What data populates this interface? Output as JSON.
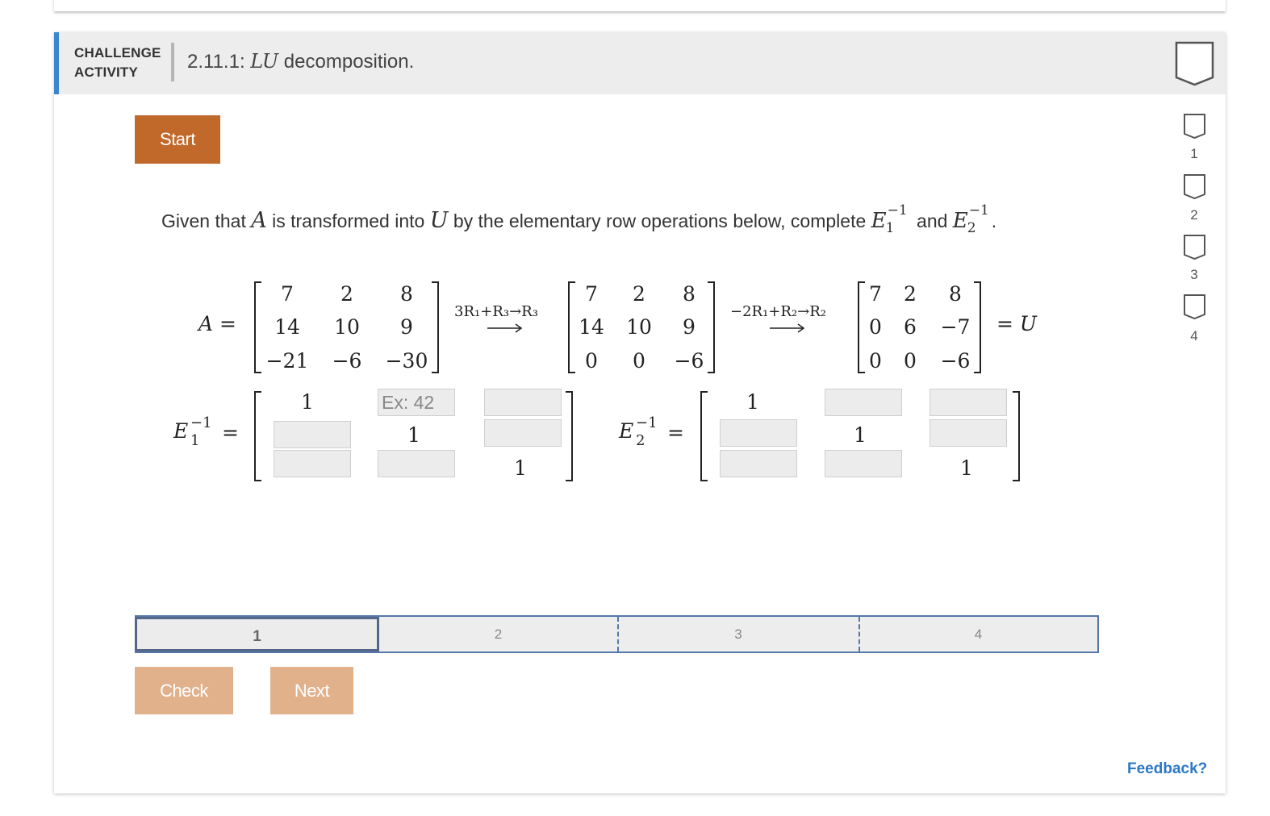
{
  "header": {
    "activity_type_line1": "CHALLENGE",
    "activity_type_line2": "ACTIVITY",
    "number": "2.11.1: ",
    "title_math": "LU",
    "title_text": " decomposition."
  },
  "start_label": "Start",
  "prompt": {
    "text1": "Given that ",
    "A": "A",
    "text2": " is transformed into ",
    "U": "U",
    "text3": " by the elementary row operations below, complete ",
    "E": "E",
    "sub1": "1",
    "sup": "−1",
    "and": " and ",
    "sub2": "2",
    "end": "."
  },
  "matrices": {
    "A_label": "A",
    "equals": "=",
    "A": [
      [
        "7",
        "2",
        "8"
      ],
      [
        "14",
        "10",
        "9"
      ],
      [
        "−21",
        "−6",
        "−30"
      ]
    ],
    "op1": "3R₁+R₃→R₃",
    "M1": [
      [
        "7",
        "2",
        "8"
      ],
      [
        "14",
        "10",
        "9"
      ],
      [
        "0",
        "0",
        "−6"
      ]
    ],
    "op2": "−2R₁+R₂→R₂",
    "U": [
      [
        "7",
        "2",
        "8"
      ],
      [
        "0",
        "6",
        "−7"
      ],
      [
        "0",
        "0",
        "−6"
      ]
    ],
    "U_label": "= U"
  },
  "E1inv": {
    "label_E": "E",
    "label_sub": "1",
    "label_sup": "−1",
    "equals": "=",
    "r1c1": "1",
    "r1c2_placeholder": "Ex: 42",
    "r2c2": "1",
    "r3c3": "1"
  },
  "E2inv": {
    "label_E": "E",
    "label_sub": "2",
    "label_sup": "−1",
    "equals": "=",
    "r1c1": "1",
    "r2c2": "1",
    "r3c3": "1"
  },
  "progress": {
    "levels": [
      "1",
      "2",
      "3",
      "4"
    ],
    "current": "1"
  },
  "check_label": "Check",
  "next_label": "Next",
  "feedback_label": "Feedback?",
  "side_levels": [
    "1",
    "2",
    "3",
    "4"
  ],
  "colors": {
    "accent_blue": "#3a86d0",
    "start_orange": "#c1692b",
    "disabled_orange": "#e1b18c",
    "link_blue": "#2b78c5"
  }
}
